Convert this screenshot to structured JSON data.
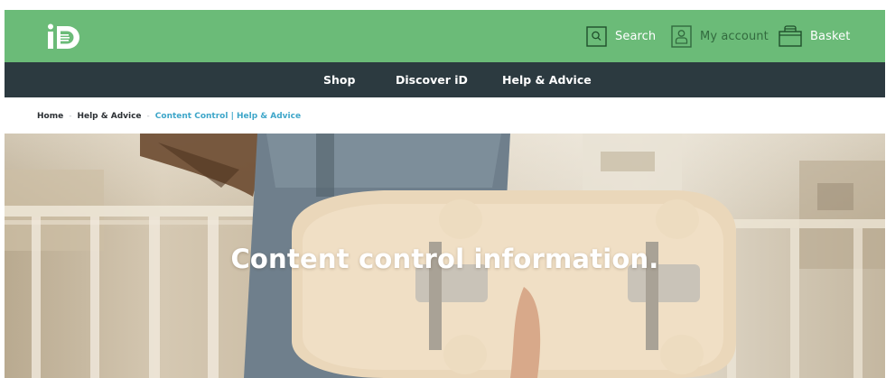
{
  "brand": {
    "logo_text": "iD",
    "primary_color": "#6bbb78",
    "nav_color": "#2c3a40",
    "link_color": "#3ea6c9"
  },
  "topnav": {
    "search": {
      "label": "Search",
      "icon": "search-icon"
    },
    "account": {
      "label": "My account",
      "icon": "account-icon"
    },
    "basket": {
      "label": "Basket",
      "icon": "basket-icon"
    }
  },
  "mainnav": {
    "items": [
      {
        "label": "Shop"
      },
      {
        "label": "Discover iD"
      },
      {
        "label": "Help & Advice"
      }
    ]
  },
  "breadcrumb": {
    "items": [
      {
        "label": "Home"
      },
      {
        "label": "Help & Advice"
      },
      {
        "label": "Content Control | Help & Advice"
      }
    ],
    "separator": "-"
  },
  "hero": {
    "title": "Content control information.",
    "image": "person-holding-skateboard"
  }
}
